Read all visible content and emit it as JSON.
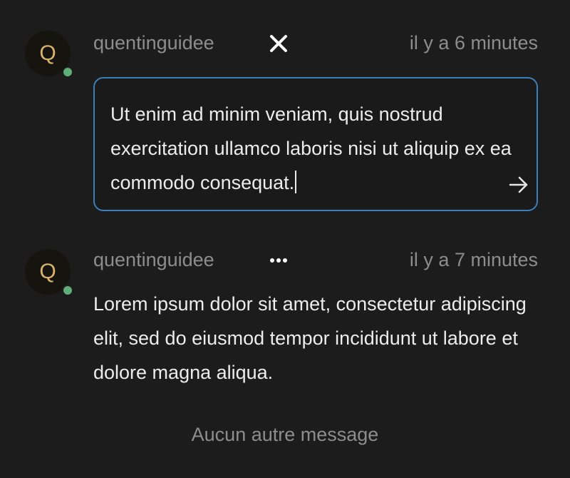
{
  "comments": [
    {
      "avatar_initial": "Q",
      "author": "quentinguidee",
      "time": "il y a 6 minutes",
      "editing": true,
      "draft_text": "Ut enim ad minim veniam, quis nostrud exercitation ullamco laboris nisi ut aliquip ex ea commodo consequat."
    },
    {
      "avatar_initial": "Q",
      "author": "quentinguidee",
      "time": "il y a 7 minutes",
      "editing": false,
      "body": "Lorem ipsum dolor sit amet, consectetur adipiscing elit, sed do eiusmod tempor incididunt ut labore et dolore magna aliqua."
    }
  ],
  "footer": {
    "no_more_messages": "Aucun autre message"
  },
  "icons": {
    "close": "close-icon",
    "send": "arrow-right-icon",
    "more": "more-horizontal-icon"
  },
  "colors": {
    "background": "#1c1c1c",
    "avatar_letter": "#d9b26b",
    "online_status": "#5fae79",
    "editor_border": "#3c7fb8",
    "muted_text": "#8d8d8d"
  }
}
